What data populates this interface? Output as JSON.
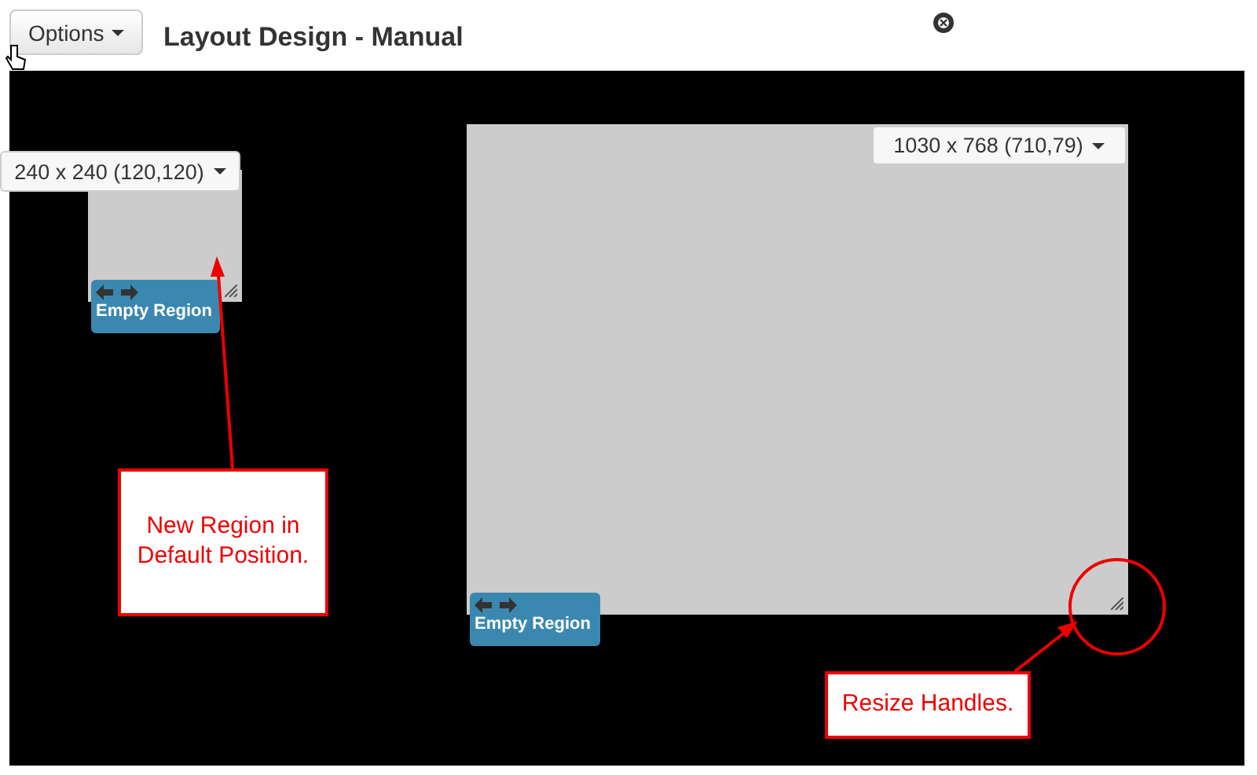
{
  "toolbar": {
    "options_button": "Options",
    "title": "Layout Design - Manual"
  },
  "regions": [
    {
      "size_label": "240 x 240 (120,120)",
      "tag": "Empty Region"
    },
    {
      "size_label": "1030 x 768 (710,79)",
      "tag": "Empty Region"
    }
  ],
  "annotations": [
    {
      "text": "New Region in Default Position."
    },
    {
      "text": "Resize Handles."
    }
  ]
}
